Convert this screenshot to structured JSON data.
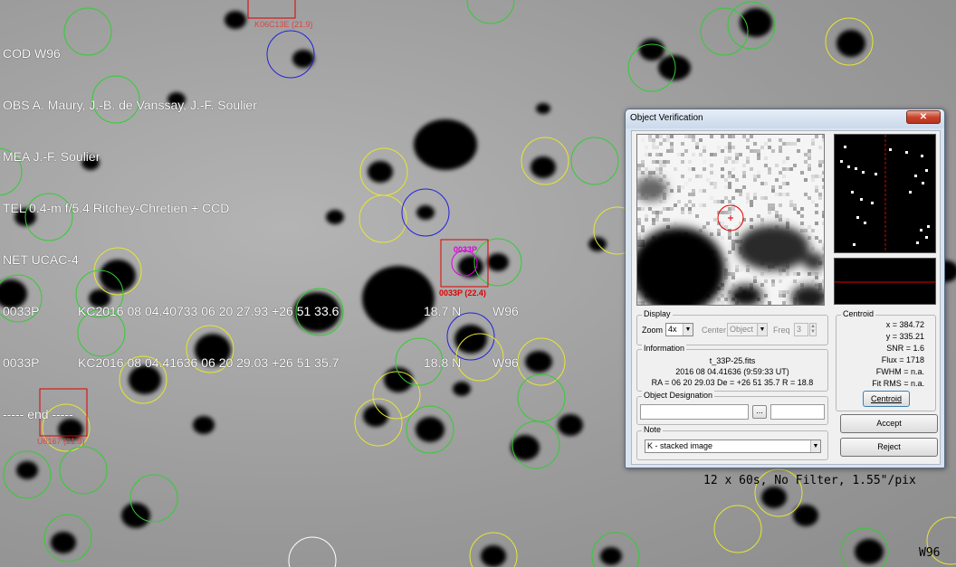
{
  "header": {
    "lines": [
      "COD W96",
      "OBS A. Maury, J.-B. de Vanssay, J.-F. Soulier",
      "MEA J.-F. Soulier",
      "TEL 0.4-m f/5.4 Ritchey-Chretien + CCD",
      "NET UCAC-4"
    ],
    "observations": [
      {
        "designation": "0033P",
        "record": "KC2016 08 04.40733 06 20 27.93 +26 51 33.6",
        "mag": "18.7 N",
        "code": "W96"
      },
      {
        "designation": "0033P",
        "record": "KC2016 08 04.41636 06 20 29.03 +26 51 35.7",
        "mag": "18.8 N",
        "code": "W96"
      }
    ],
    "end_line": "----- end -----"
  },
  "image_labels": {
    "target": "0033P (22.4)",
    "target_magenta": "0033P",
    "ref_top": "K06C13E (21.9)",
    "ref_left": "U6167 (21.9)"
  },
  "caption": "12 x 60s, No Filter, 1.55\"/pix",
  "corner_code": "W96",
  "dialog": {
    "title": "Object Verification",
    "close_label": "✕",
    "display": {
      "group": "Display",
      "zoom_label": "Zoom",
      "zoom_value": "4x",
      "center_label": "Center",
      "center_value": "Object",
      "freq_label": "Freq",
      "freq_value": "3"
    },
    "information": {
      "group": "Information",
      "filename": "t_33P-25.fits",
      "date": "2016 08 04.41636 (9:59:33 UT)",
      "coords": "RA = 06 20 29.03   De = +26 51 35.7   R = 18.8"
    },
    "designation": {
      "group": "Object Designation",
      "browse_label": "..."
    },
    "note": {
      "group": "Note",
      "value": "K - stacked image"
    },
    "centroid": {
      "group": "Centroid",
      "x": "x = 384.72",
      "y": "y = 335.21",
      "snr": "SNR = 1.6",
      "flux": "Flux = 1718",
      "fwhm": "FWHM = n.a.",
      "fit_rms": "Fit RMS = n.a.",
      "button": "Centroid"
    },
    "accept_label": "Accept",
    "reject_label": "Reject"
  },
  "colors": {
    "text_overlay": "#ffffff",
    "ref_circle_green": "#33cc33",
    "ref_circle_yellow": "#e6e633",
    "ref_circle_blue": "#2222dd",
    "target_box": "#e00000",
    "target_magenta": "#e000e0"
  }
}
